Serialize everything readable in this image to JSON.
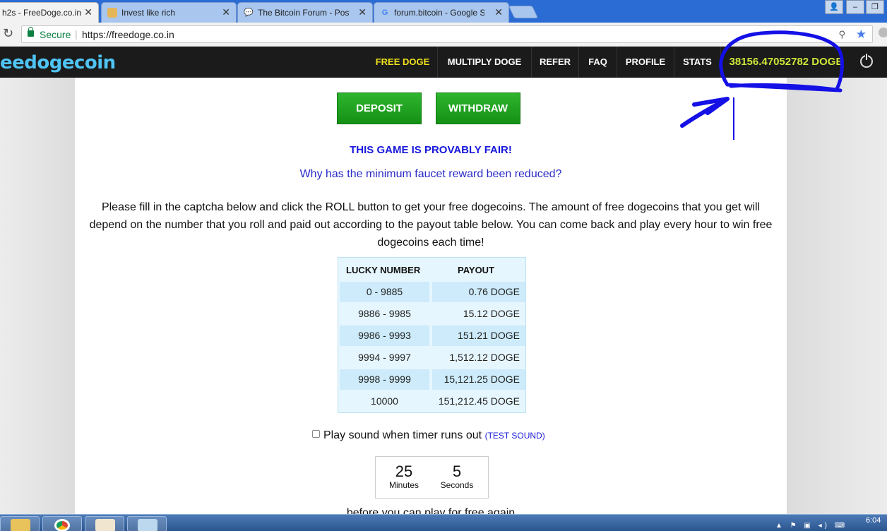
{
  "browser": {
    "tabs": [
      {
        "title": "h2s - FreeDoge.co.in",
        "active": true
      },
      {
        "title": "Invest like rich",
        "active": false
      },
      {
        "title": "The Bitcoin Forum - Post",
        "active": false
      },
      {
        "title": "forum.bitcoin - Google S",
        "active": false
      }
    ],
    "secure_label": "Secure",
    "url": "https://freedoge.co.in",
    "reload_icon": "reload-icon",
    "star_icon": "star-icon"
  },
  "site": {
    "logo": "eedogecoin",
    "nav": {
      "free_doge": "FREE DOGE",
      "multiply_doge": "MULTIPLY DOGE",
      "refer": "REFER",
      "faq": "FAQ",
      "profile": "PROFILE",
      "stats": "STATS"
    },
    "balance": "38156.47052782 DOGE"
  },
  "buttons": {
    "deposit": "DEPOSIT",
    "withdraw": "WITHDRAW"
  },
  "fair_text": "THIS GAME IS PROVABLY FAIR!",
  "why_link": "Why has the minimum faucet reward been reduced?",
  "intro": "Please fill in the captcha below and click the ROLL button to get your free dogecoins. The amount of free dogecoins that you get will depend on the number that you roll and paid out according to the payout table below. You can come back and play every hour to win free dogecoins each time!",
  "payout_table": {
    "headers": [
      "LUCKY NUMBER",
      "PAYOUT"
    ],
    "rows": [
      {
        "range": "0 - 9885",
        "payout": "0.76 DOGE"
      },
      {
        "range": "9886 - 9985",
        "payout": "15.12 DOGE"
      },
      {
        "range": "9986 - 9993",
        "payout": "151.21 DOGE"
      },
      {
        "range": "9994 - 9997",
        "payout": "1,512.12 DOGE"
      },
      {
        "range": "9998 - 9999",
        "payout": "15,121.25 DOGE"
      },
      {
        "range": "10000",
        "payout": "151,212.45 DOGE"
      }
    ]
  },
  "sound": {
    "label": "Play sound when timer runs out",
    "test": "(TEST SOUND)",
    "checked": false
  },
  "timer": {
    "minutes": "25",
    "minutes_label": "Minutes",
    "seconds": "5",
    "seconds_label": "Seconds"
  },
  "before_text": "before you can play for free again",
  "taskbar": {
    "clock": "6:04"
  },
  "colors": {
    "nav_bg": "#1b1b1b",
    "active_nav": "#f2e21d",
    "balance": "#cfe53a",
    "green_button": "#1ea01e",
    "link_blue": "#1818dc",
    "table_bg": "#e6f6ff",
    "annotation_blue": "#1410e6"
  }
}
